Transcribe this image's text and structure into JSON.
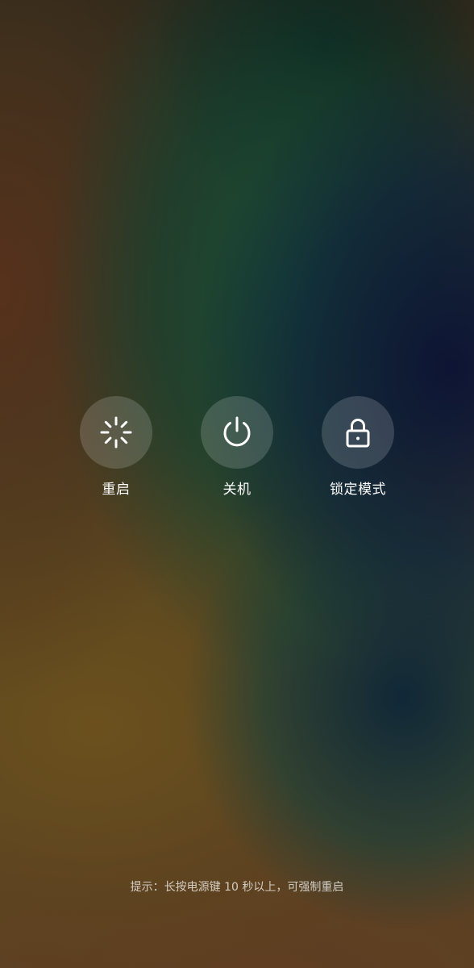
{
  "actions": {
    "restart": {
      "label": "重启",
      "icon": "restart-spinner-icon"
    },
    "power_off": {
      "label": "关机",
      "icon": "power-icon"
    },
    "lockdown": {
      "label": "锁定模式",
      "icon": "lock-icon"
    }
  },
  "hint": "提示：长按电源键 10 秒以上，可强制重启",
  "colors": {
    "icon": "#ffffff",
    "button_bg": "rgba(255,255,255,0.16)",
    "hint_text": "rgba(255,255,255,0.72)"
  }
}
